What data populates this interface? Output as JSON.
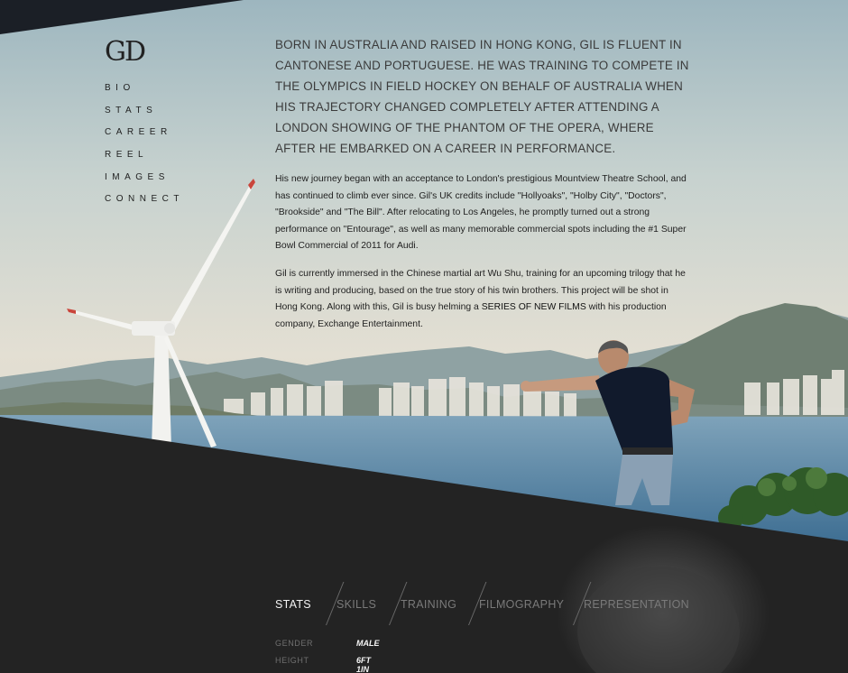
{
  "logo": {
    "text": "GD"
  },
  "nav": {
    "items": [
      {
        "label": "BIO",
        "name": "nav-item-bio"
      },
      {
        "label": "STATS",
        "name": "nav-item-stats"
      },
      {
        "label": "CAREER",
        "name": "nav-item-career"
      },
      {
        "label": "REEL",
        "name": "nav-item-reel"
      },
      {
        "label": "IMAGES",
        "name": "nav-item-images"
      },
      {
        "label": "CONNECT",
        "name": "nav-item-connect"
      }
    ]
  },
  "bio": {
    "lead": "BORN IN AUSTRALIA AND RAISED IN HONG KONG, GIL IS FLUENT IN CANTONESE AND PORTUGUESE. HE WAS TRAINING TO COMPETE IN THE OLYMPICS IN FIELD HOCKEY ON BEHALF OF AUSTRALIA WHEN HIS TRAJECTORY CHANGED COMPLETELY AFTER ATTENDING A LONDON SHOWING OF THE PHANTOM OF THE OPERA, WHERE AFTER HE EMBARKED ON A CAREER IN PERFORMANCE.",
    "p1": "His new journey began with an acceptance to London's prestigious Mountview Theatre School, and has continued to climb ever since. Gil's UK credits include \"Hollyoaks\", \"Holby City\", \"Doctors\", \"Brookside\" and \"The Bill\". After relocating to Los Angeles, he promptly turned out a strong performance on \"Entourage\", as well as many memorable commercial spots including the #1 Super Bowl Commercial of 2011 for Audi.",
    "p2_before": "Gil is currently immersed in the Chinese martial art Wu Shu, training for an upcoming trilogy that he is writing and producing, based on the true story of his twin brothers. This project will be shot in Hong Kong. Along with this, Gil is busy helming a ",
    "p2_link": "SERIES OF NEW FILMS",
    "p2_after": " with his production company, Exchange Entertainment."
  },
  "tabs": {
    "items": [
      {
        "label": "STATS",
        "active": true
      },
      {
        "label": "SKILLS",
        "active": false
      },
      {
        "label": "TRAINING",
        "active": false
      },
      {
        "label": "FILMOGRAPHY",
        "active": false
      },
      {
        "label": "REPRESENTATION",
        "active": false
      }
    ]
  },
  "stats": {
    "rows": [
      {
        "label": "GENDER",
        "value": "MALE"
      },
      {
        "label": "HEIGHT",
        "value": "6FT 1IN"
      }
    ]
  },
  "colors": {
    "sky_top": "#9fb8c0",
    "sky_bottom": "#e6e2d6",
    "sea": "#5c88a6",
    "dark_panel": "#232323",
    "text_dark": "#2a2a2a",
    "tab_active": "#f3f3f3",
    "tab_inactive": "#7a7a7a"
  }
}
